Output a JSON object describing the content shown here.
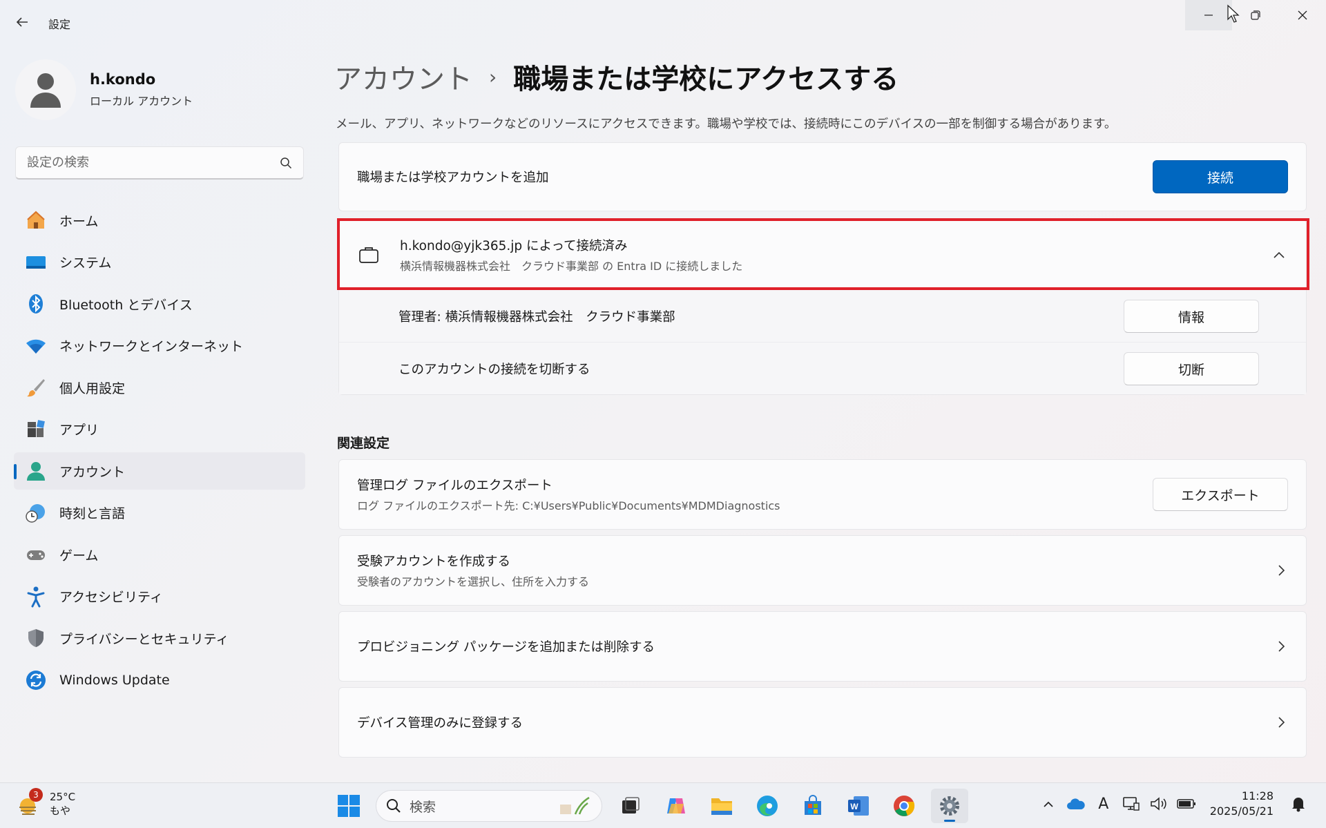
{
  "window": {
    "title": "設定"
  },
  "profile": {
    "name": "h.kondo",
    "type": "ローカル アカウント"
  },
  "search": {
    "placeholder": "設定の検索"
  },
  "nav": {
    "items": [
      {
        "label": "ホーム",
        "icon": "home-icon"
      },
      {
        "label": "システム",
        "icon": "system-icon"
      },
      {
        "label": "Bluetooth とデバイス",
        "icon": "bluetooth-icon"
      },
      {
        "label": "ネットワークとインターネット",
        "icon": "network-icon"
      },
      {
        "label": "個人用設定",
        "icon": "brush-icon"
      },
      {
        "label": "アプリ",
        "icon": "apps-icon"
      },
      {
        "label": "アカウント",
        "icon": "account-icon",
        "active": true
      },
      {
        "label": "時刻と言語",
        "icon": "time-language-icon"
      },
      {
        "label": "ゲーム",
        "icon": "gamepad-icon"
      },
      {
        "label": "アクセシビリティ",
        "icon": "accessibility-icon"
      },
      {
        "label": "プライバシーとセキュリティ",
        "icon": "shield-icon"
      },
      {
        "label": "Windows Update",
        "icon": "update-icon"
      }
    ]
  },
  "main": {
    "breadcrumb_parent": "アカウント",
    "breadcrumb_sep": "›",
    "breadcrumb_current": "職場または学校にアクセスする",
    "description": "メール、アプリ、ネットワークなどのリソースにアクセスできます。職場や学校では、接続時にこのデバイスの一部を制御する場合があります。",
    "add_account": {
      "label": "職場または学校アカウントを追加",
      "button": "接続"
    },
    "connected": {
      "title": "h.kondo@yjk365.jp によって接続済み",
      "subtitle": "横浜情報機器株式会社　クラウド事業部 の Entra ID に接続しました",
      "admin_label": "管理者: 横浜情報機器株式会社　クラウド事業部",
      "info_button": "情報",
      "disconnect_label": "このアカウントの接続を切断する",
      "disconnect_button": "切断"
    },
    "related_title": "関連設定",
    "related": {
      "export_title": "管理ログ ファイルのエクスポート",
      "export_sub": "ログ ファイルのエクスポート先: C:¥Users¥Public¥Documents¥MDMDiagnostics",
      "export_button": "エクスポート",
      "exam_title": "受験アカウントを作成する",
      "exam_sub": "受験者のアカウントを選択し、住所を入力する",
      "provisioning_title": "プロビジョニング パッケージを追加または削除する",
      "mdm_title": "デバイス管理のみに登録する"
    }
  },
  "taskbar": {
    "weather_temp": "25°C",
    "weather_desc": "もや",
    "weather_badge": "3",
    "search_label": "検索",
    "time": "11:28",
    "date": "2025/05/21",
    "ime": "A"
  },
  "colors": {
    "accent": "#0067c0",
    "highlight": "#e0202a"
  }
}
